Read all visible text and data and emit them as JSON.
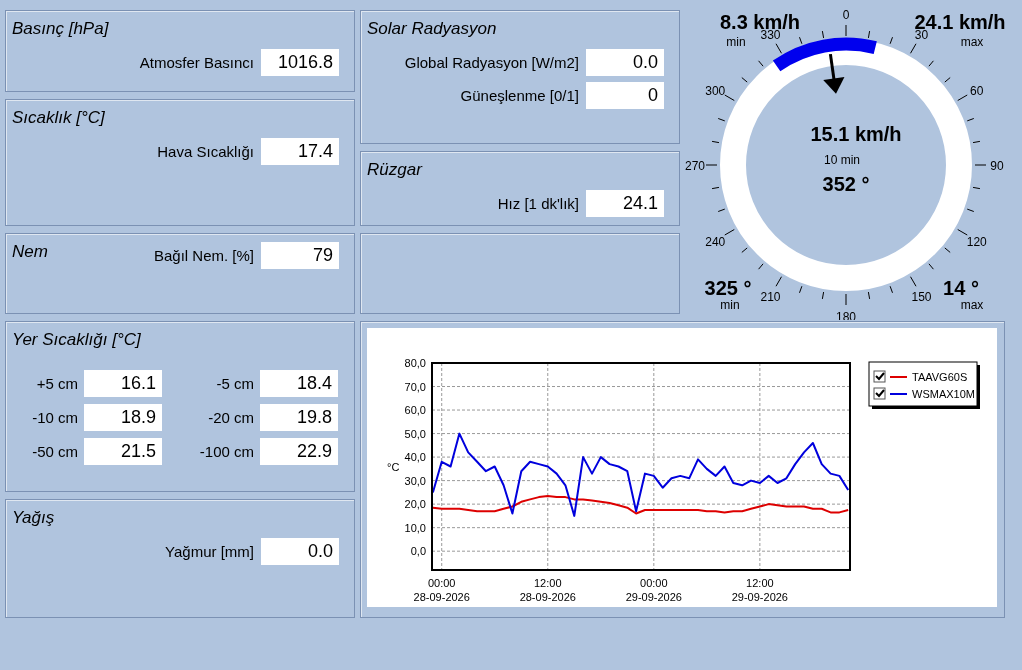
{
  "left_panels": [
    {
      "kind": "stacked",
      "title": "Basınç [hPa]",
      "fields": [
        {
          "label": "Atmosfer Basıncı",
          "value": "1016.8"
        }
      ]
    },
    {
      "kind": "stacked",
      "title": "Sıcaklık [°C]",
      "fields": [
        {
          "label": "Hava Sıcaklığı",
          "value": "17.4"
        }
      ]
    },
    {
      "kind": "inline",
      "title": "Nem",
      "fields": [
        {
          "label": "Bağıl Nem. [%]",
          "value": "79"
        }
      ]
    },
    {
      "kind": "grid",
      "title": "Yer Sıcaklığı [°C]",
      "fields": [
        {
          "label": "+5 cm",
          "value": "16.1"
        },
        {
          "label": "-5 cm",
          "value": "18.4"
        },
        {
          "label": "-10 cm",
          "value": "18.9"
        },
        {
          "label": "-20 cm",
          "value": "19.8"
        },
        {
          "label": "-50 cm",
          "value": "21.5"
        },
        {
          "label": "-100 cm",
          "value": "22.9"
        }
      ]
    },
    {
      "kind": "stacked",
      "title": "Yağış",
      "fields": [
        {
          "label": "Yağmur [mm]",
          "value": "0.0"
        }
      ]
    }
  ],
  "middle_panels": [
    {
      "kind": "stacked",
      "title": "Solar Radyasyon",
      "fields": [
        {
          "label": "Global Radyasyon [W/m2]",
          "value": "0.0"
        },
        {
          "label": "Güneşlenme [0/1]",
          "value": "0"
        }
      ]
    },
    {
      "kind": "stacked",
      "title": "Rüzgar",
      "fields": [
        {
          "label": "Hız [1 dk'lık]",
          "value": "24.1"
        }
      ]
    },
    {
      "kind": "empty"
    }
  ],
  "wind_gauge": {
    "min_speed": "8.3 km/h",
    "min_speed_label": "min",
    "max_speed": "24.1 km/h",
    "max_speed_label": "max",
    "speed": "15.1 km/h",
    "period": "10 min",
    "direction": "352 °",
    "min_direction": "325 °",
    "min_direction_label": "min",
    "max_direction": "14 °",
    "max_direction_label": "max",
    "dial_labels": [
      "0",
      "30",
      "60",
      "90",
      "120",
      "150",
      "180",
      "210",
      "240",
      "270",
      "300",
      "330"
    ]
  },
  "chart": {
    "chart_data": {
      "type": "line",
      "ylabel": "°C",
      "grid": true,
      "legend": "right",
      "ylim": [
        -8,
        80
      ],
      "categories": [
        null,
        "00:00 28-09-2026",
        null,
        null,
        null,
        null,
        null,
        null,
        null,
        null,
        null,
        null,
        null,
        "12:00 28-09-2026",
        null,
        null,
        null,
        null,
        null,
        null,
        null,
        null,
        null,
        null,
        null,
        "00:00 29-09-2026",
        null,
        null,
        null,
        null,
        null,
        null,
        null,
        null,
        null,
        null,
        null,
        "12:00 29-09-2026",
        null,
        null,
        null,
        null,
        null,
        null,
        null,
        null,
        null,
        null
      ],
      "yticks": [
        {
          "value": 0,
          "label": "0,0"
        },
        {
          "value": 10,
          "label": "10,0"
        },
        {
          "value": 20,
          "label": "20,0"
        },
        {
          "value": 30,
          "label": "30,0"
        },
        {
          "value": 40,
          "label": "40,0"
        },
        {
          "value": 50,
          "label": "50,0"
        },
        {
          "value": 60,
          "label": "60,0"
        },
        {
          "value": 70,
          "label": "70,0"
        },
        {
          "value": 80,
          "label": "80,0"
        }
      ],
      "series": [
        {
          "name": "TAAVG60S",
          "color": "#dd0000",
          "values": [
            18.5,
            18,
            18,
            18,
            17.5,
            17,
            17,
            17,
            18,
            19,
            21,
            22,
            23,
            23.5,
            23,
            23,
            22,
            22,
            21.5,
            21,
            20.5,
            19.5,
            18.5,
            16,
            17.5,
            17.5,
            17.5,
            17.5,
            17.5,
            17.5,
            17.5,
            17,
            17,
            16.5,
            17,
            17,
            18,
            19,
            20,
            19.5,
            19,
            19,
            19,
            18,
            18,
            16.5,
            16.5,
            17.5
          ]
        },
        {
          "name": "WSMAX10M",
          "color": "#0000dd",
          "values": [
            25,
            38,
            36,
            50,
            42,
            38,
            34,
            36,
            28,
            16,
            34,
            38,
            37,
            36,
            33,
            28,
            15,
            40,
            33,
            40,
            37,
            36,
            34,
            17,
            33,
            32,
            27,
            31,
            32,
            31,
            39,
            35,
            32,
            36,
            29,
            28,
            30,
            29,
            32,
            29,
            31,
            37,
            42,
            46,
            37,
            33,
            32,
            26
          ]
        }
      ]
    },
    "legend_checkboxes": [
      {
        "checked": true
      },
      {
        "checked": true
      }
    ]
  }
}
